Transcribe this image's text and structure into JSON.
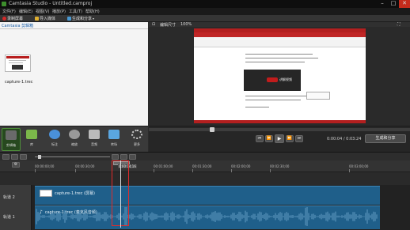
{
  "window": {
    "title": "Camtasia Studio - Untitled.camproj",
    "minimize": "–",
    "maximize": "□",
    "close": "✕"
  },
  "menu": [
    "文件(F)",
    "编辑(E)",
    "视图(V)",
    "播放(P)",
    "工具(T)",
    "帮助(H)"
  ],
  "toolbar": {
    "record": "录制屏幕",
    "import": "导入媒体",
    "produce": "生成和分享"
  },
  "clip_bin": {
    "header": "Camtasia 剪辑箱",
    "clips": [
      {
        "name": "capture-1.trec"
      }
    ]
  },
  "preview": {
    "edit": "编辑尺寸",
    "zoom": "100%"
  },
  "canvas_doc": {
    "video_label": "讲解视频"
  },
  "tools": [
    {
      "label": "剪辑箱"
    },
    {
      "label": "库"
    },
    {
      "label": "标注"
    },
    {
      "label": "缩放"
    },
    {
      "label": "音频"
    },
    {
      "label": "转场"
    },
    {
      "label": "更多"
    }
  ],
  "player": {
    "time": "0:00:04 / 0:03:24",
    "produce_button": "生成和分享"
  },
  "timeline": {
    "ticks": [
      "00:00:00;00",
      "00:00:30;00",
      "00:01:00;00",
      "00:01:30;00",
      "00:02:00;00",
      "00:02:30;00",
      "00:03:00;00"
    ],
    "playhead": "0:00:04;16",
    "tracks": [
      {
        "name": "轨道 2",
        "clip": "capture-1.trec (屏幕)"
      },
      {
        "name": "轨道 1",
        "clip": "capture-1.trec (麦克风音频)"
      }
    ]
  },
  "colors": {
    "accent": "#1f5f8a",
    "selection": "#e12b2b",
    "active_tool": "#4e8d3a"
  }
}
